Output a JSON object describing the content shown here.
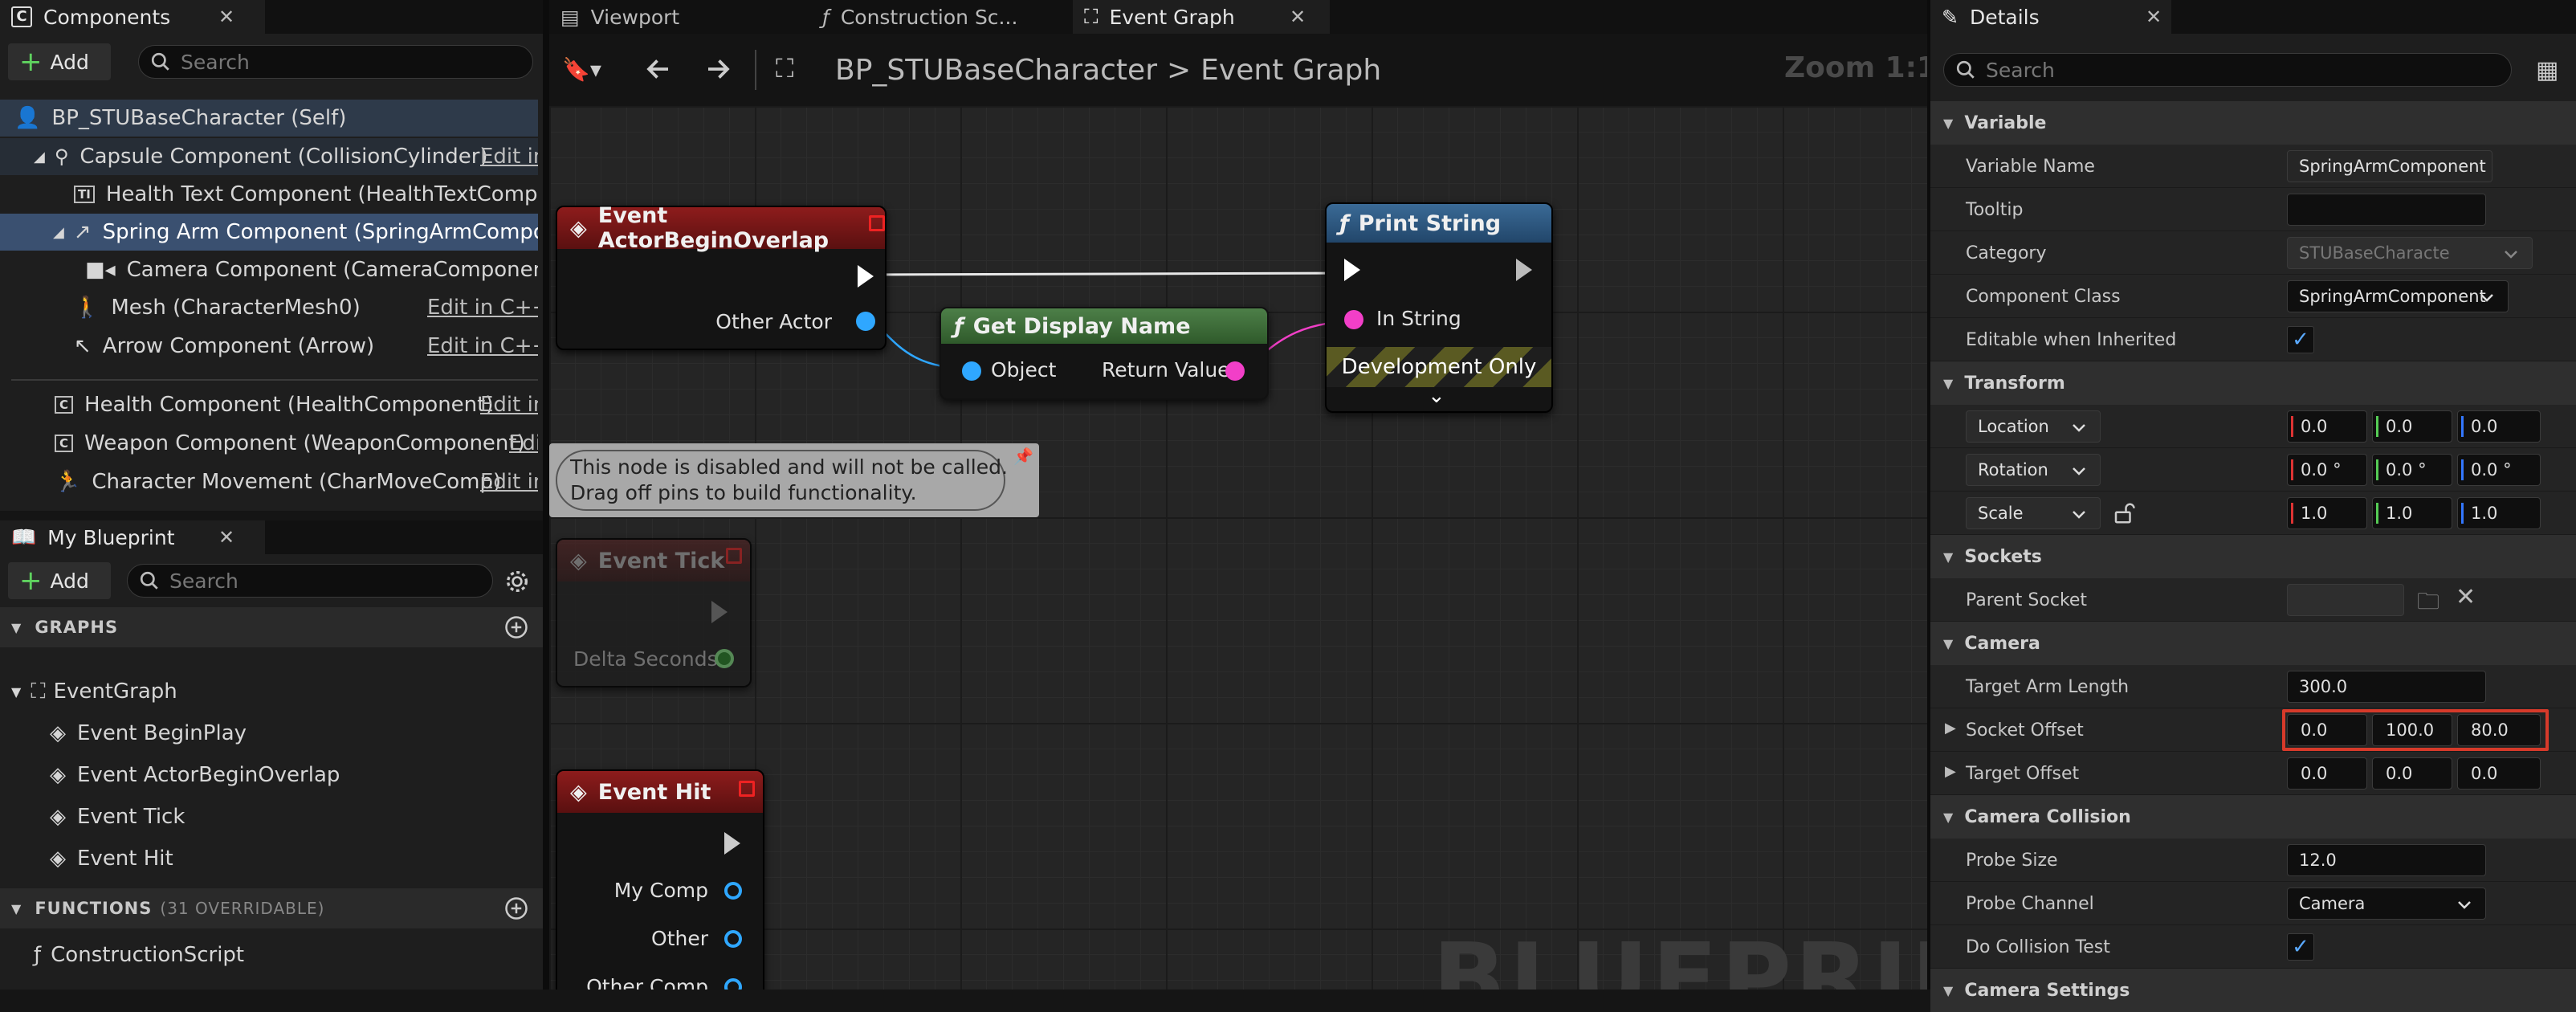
{
  "components_panel": {
    "tab_title": "Components",
    "add_label": "Add",
    "search_placeholder": "Search",
    "items": [
      {
        "label": "BP_STUBaseCharacter (Self)"
      },
      {
        "label": "Capsule Component (CollisionCylinder)",
        "edit": "Edit in C++"
      },
      {
        "label": "Health Text Component (HealthTextComponent)"
      },
      {
        "label": "Spring Arm Component (SpringArmComponent)"
      },
      {
        "label": "Camera Component (CameraComponent)"
      },
      {
        "label": "Mesh (CharacterMesh0)",
        "edit": "Edit in C++"
      },
      {
        "label": "Arrow Component (Arrow)",
        "edit": "Edit in C++"
      },
      {
        "label": "Health Component (HealthComponent)",
        "edit": "Edit in C++"
      },
      {
        "label": "Weapon Component (WeaponComponent)",
        "edit": "Edit in C++"
      },
      {
        "label": "Character Movement (CharMoveComp)",
        "edit": "Edit in C++"
      }
    ]
  },
  "my_blueprint": {
    "tab_title": "My Blueprint",
    "add_label": "Add",
    "search_placeholder": "Search",
    "graphs_header": "GRAPHS",
    "event_graph": "EventGraph",
    "events": [
      "Event BeginPlay",
      "Event ActorBeginOverlap",
      "Event Tick",
      "Event Hit"
    ],
    "functions_header": "FUNCTIONS",
    "functions_count": "(31 OVERRIDABLE)",
    "construction_script": "ConstructionScript"
  },
  "editor_tabs": {
    "viewport": "Viewport",
    "construction": "Construction Sc...",
    "event_graph": "Event Graph"
  },
  "graph_toolbar": {
    "breadcrumb_root": "BP_STUBaseCharacter",
    "breadcrumb_sep": ">",
    "breadcrumb_current": "Event Graph",
    "zoom": "Zoom 1:1"
  },
  "graph": {
    "watermark": "BLUEPRINT",
    "node_overlap": {
      "title": "Event ActorBeginOverlap",
      "pin_other_actor": "Other Actor"
    },
    "node_display_name": {
      "title": "Get Display Name",
      "pin_object": "Object",
      "pin_return": "Return Value"
    },
    "node_print": {
      "title": "Print String",
      "pin_in_string": "In String",
      "dev_only": "Development Only"
    },
    "disabled_comment": {
      "line1": "This node is disabled and will not be called.",
      "line2": "Drag off pins to build functionality."
    },
    "node_tick": {
      "title": "Event Tick",
      "pin_delta": "Delta Seconds"
    },
    "node_hit": {
      "title": "Event Hit",
      "pin_my_comp": "My Comp",
      "pin_other": "Other",
      "pin_other_comp": "Other Comp"
    }
  },
  "details": {
    "tab_title": "Details",
    "search_placeholder": "Search",
    "variable": {
      "header": "Variable",
      "name_label": "Variable Name",
      "name_value": "SpringArmComponent",
      "tooltip_label": "Tooltip",
      "tooltip_value": "",
      "category_label": "Category",
      "category_value": "STUBaseCharacte",
      "class_label": "Component Class",
      "class_value": "SpringArmComponent",
      "editable_label": "Editable when Inherited"
    },
    "transform": {
      "header": "Transform",
      "location_label": "Location",
      "location": [
        "0.0",
        "0.0",
        "0.0"
      ],
      "rotation_label": "Rotation",
      "rotation": [
        "0.0 °",
        "0.0 °",
        "0.0 °"
      ],
      "scale_label": "Scale",
      "scale": [
        "1.0",
        "1.0",
        "1.0"
      ]
    },
    "sockets": {
      "header": "Sockets",
      "parent_label": "Parent Socket"
    },
    "camera": {
      "header": "Camera",
      "arm_length_label": "Target Arm Length",
      "arm_length": "300.0",
      "socket_offset_label": "Socket Offset",
      "socket_offset": [
        "0.0",
        "100.0",
        "80.0"
      ],
      "target_offset_label": "Target Offset",
      "target_offset": [
        "0.0",
        "0.0",
        "0.0"
      ]
    },
    "collision": {
      "header": "Camera Collision",
      "probe_size_label": "Probe Size",
      "probe_size": "12.0",
      "probe_channel_label": "Probe Channel",
      "probe_channel": "Camera",
      "do_test_label": "Do Collision Test"
    },
    "next_header": "Camera Settings"
  },
  "colors": {
    "event_header": "#7a1818",
    "pure_header": "#3f6e3a",
    "function_header": "#2a5378",
    "exec_wire": "#e8e8e8",
    "object_pin": "#2fa7ff",
    "string_pin": "#f23fc8",
    "highlight": "#d73a2a"
  }
}
